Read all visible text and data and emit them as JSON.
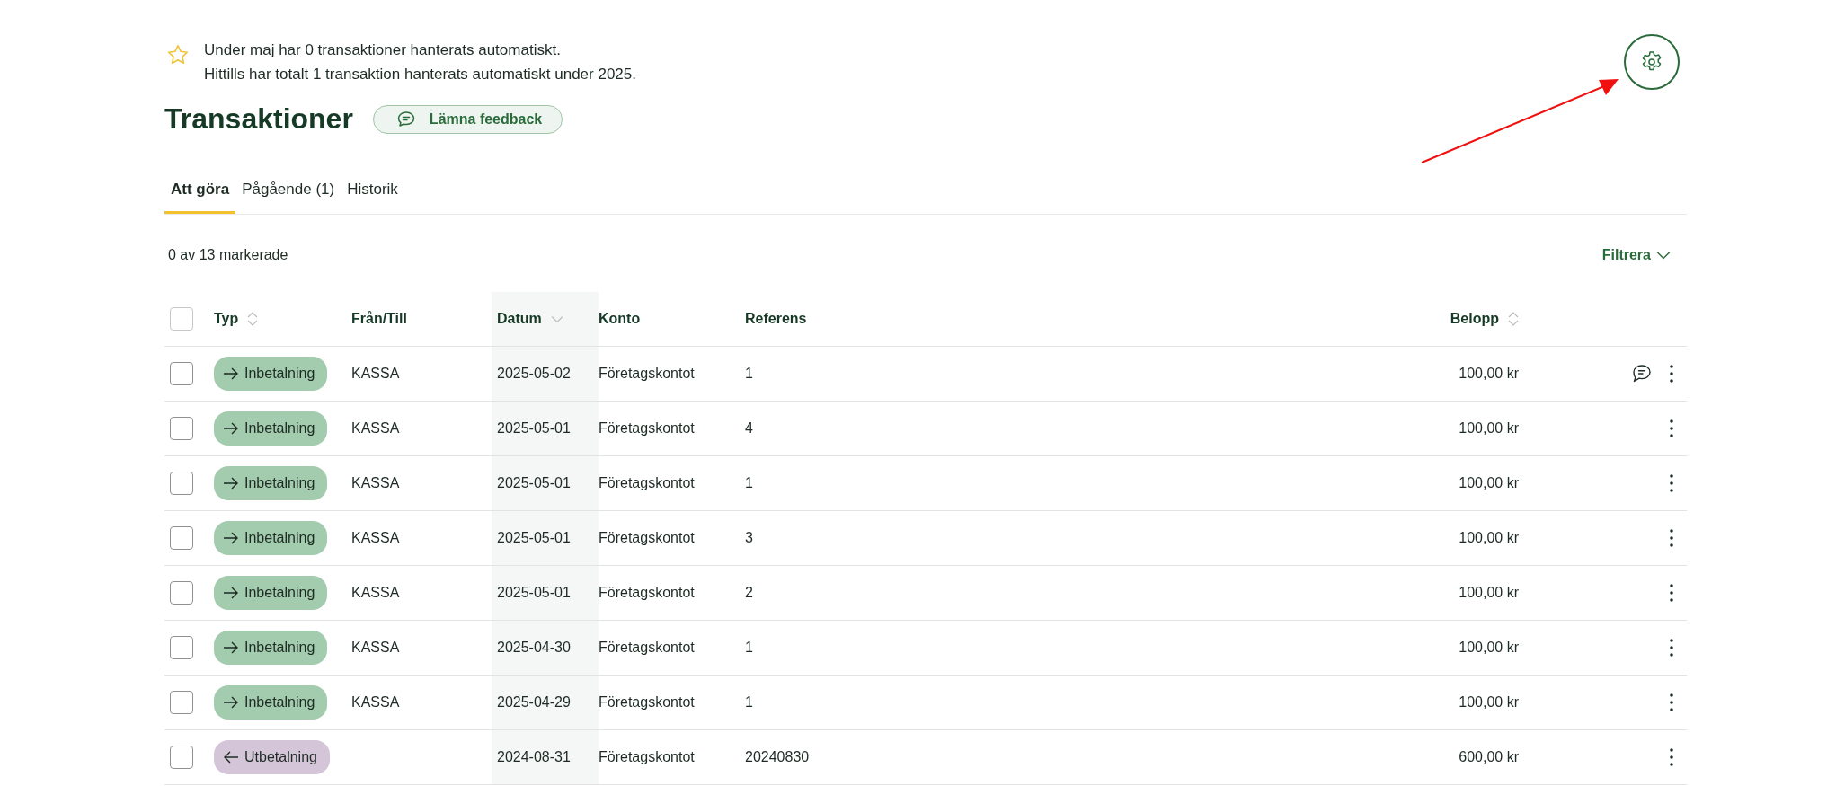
{
  "notice": {
    "lines": [
      "Under maj har 0 transaktioner hanterats automatiskt.",
      "Hittills har totalt 1 transaktion hanterats automatiskt under 2025."
    ]
  },
  "title": "Transaktioner",
  "feedback_button": "Lämna feedback",
  "tabs": [
    {
      "label": "Att göra",
      "selected": true
    },
    {
      "label": "Pågående (1)",
      "selected": false
    },
    {
      "label": "Historik",
      "selected": false
    }
  ],
  "selection_count": "0 av 13 markerade",
  "filter_button": "Filtrera",
  "table": {
    "select_all_checked": false,
    "columns": [
      {
        "label": "Typ",
        "sortable": true,
        "sorted": false
      },
      {
        "label": "Från/Till",
        "sortable": false
      },
      {
        "label": "Datum",
        "sortable": true,
        "sorted": true
      },
      {
        "label": "Konto",
        "sortable": false
      },
      {
        "label": "Referens",
        "sortable": false
      },
      {
        "label": "Belopp",
        "sortable": true,
        "sorted": false
      }
    ],
    "rows": [
      {
        "checked": false,
        "kind": "in",
        "type": "Inbetalning",
        "counterpart": "KASSA",
        "date": "2025-05-02",
        "account": "Företagskontot",
        "reference": "1",
        "amount": "100,00 kr",
        "has_comment": true
      },
      {
        "checked": false,
        "kind": "in",
        "type": "Inbetalning",
        "counterpart": "KASSA",
        "date": "2025-05-01",
        "account": "Företagskontot",
        "reference": "4",
        "amount": "100,00 kr",
        "has_comment": false
      },
      {
        "checked": false,
        "kind": "in",
        "type": "Inbetalning",
        "counterpart": "KASSA",
        "date": "2025-05-01",
        "account": "Företagskontot",
        "reference": "1",
        "amount": "100,00 kr",
        "has_comment": false
      },
      {
        "checked": false,
        "kind": "in",
        "type": "Inbetalning",
        "counterpart": "KASSA",
        "date": "2025-05-01",
        "account": "Företagskontot",
        "reference": "3",
        "amount": "100,00 kr",
        "has_comment": false
      },
      {
        "checked": false,
        "kind": "in",
        "type": "Inbetalning",
        "counterpart": "KASSA",
        "date": "2025-05-01",
        "account": "Företagskontot",
        "reference": "2",
        "amount": "100,00 kr",
        "has_comment": false
      },
      {
        "checked": false,
        "kind": "in",
        "type": "Inbetalning",
        "counterpart": "KASSA",
        "date": "2025-04-30",
        "account": "Företagskontot",
        "reference": "1",
        "amount": "100,00 kr",
        "has_comment": false
      },
      {
        "checked": false,
        "kind": "in",
        "type": "Inbetalning",
        "counterpart": "KASSA",
        "date": "2025-04-29",
        "account": "Företagskontot",
        "reference": "1",
        "amount": "100,00 kr",
        "has_comment": false
      },
      {
        "checked": false,
        "kind": "out",
        "type": "Utbetalning",
        "date": "2024-08-31",
        "account": "Företagskontot",
        "reference": "20240830",
        "amount": "600,00 kr",
        "has_comment": false
      }
    ]
  }
}
